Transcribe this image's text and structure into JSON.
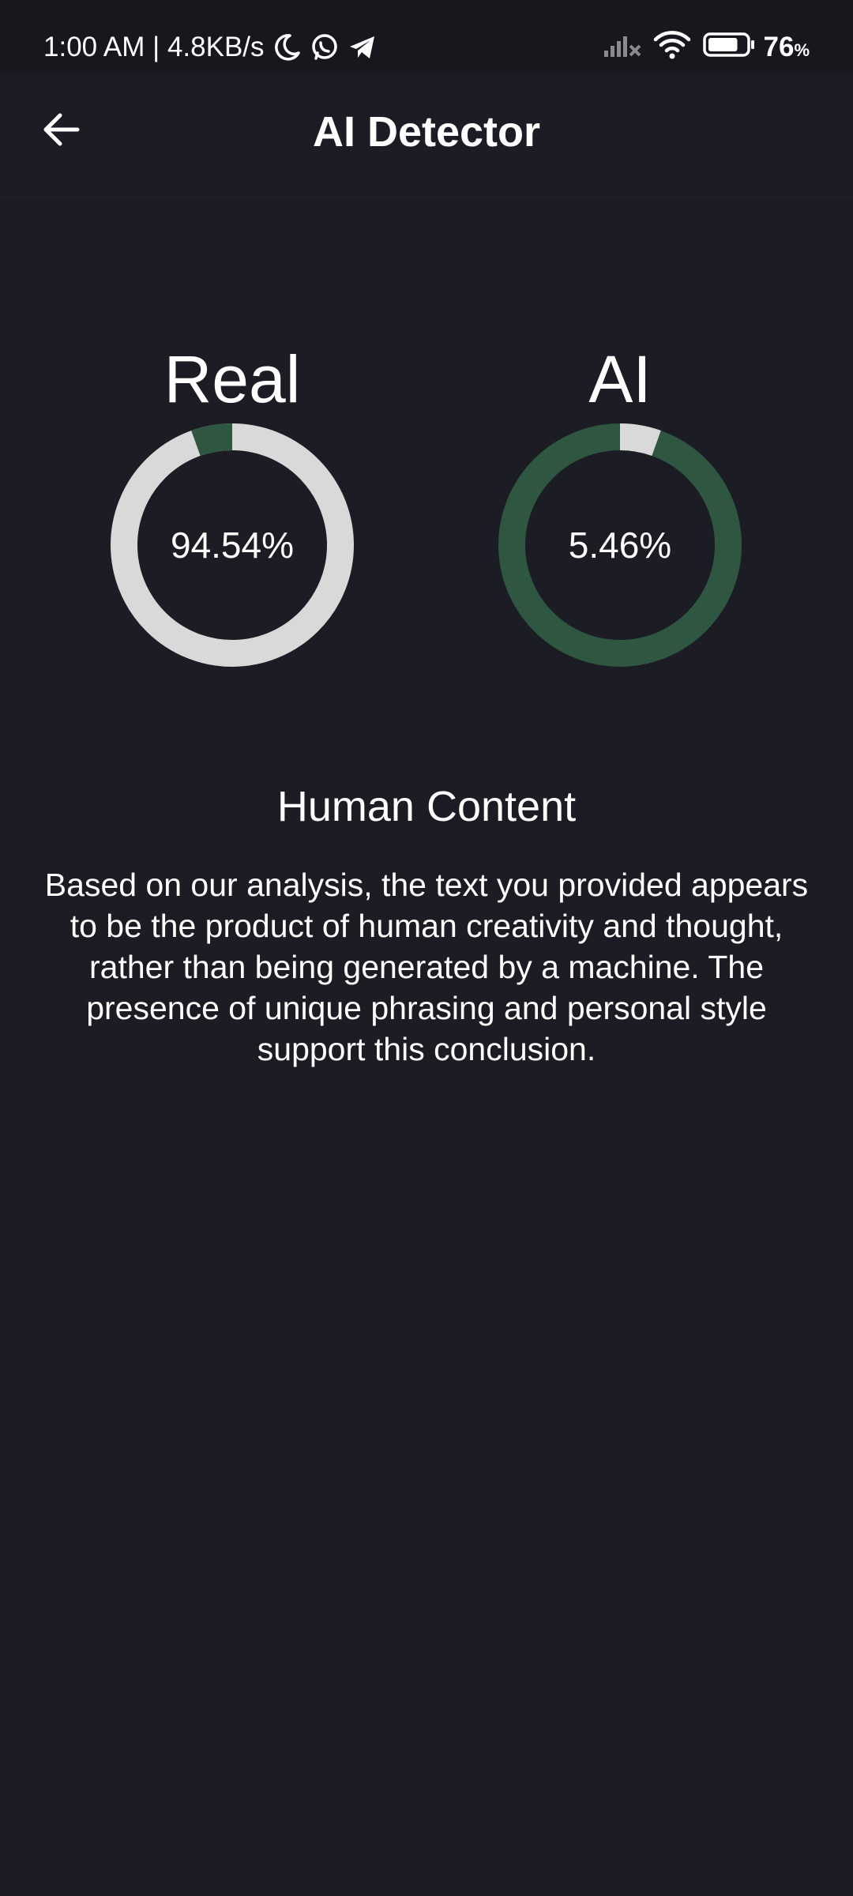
{
  "status_bar": {
    "time_speed": "1:00 AM | 4.8KB/s",
    "battery_percent": "76",
    "battery_unit": "%",
    "icons": [
      "moon-icon",
      "whatsapp-icon",
      "telegram-icon",
      "signal-icon",
      "wifi-icon",
      "battery-icon"
    ],
    "battery_level": 0.76
  },
  "app_bar": {
    "title": "AI Detector",
    "back_icon": "arrow-left-icon"
  },
  "gauges": {
    "real": {
      "label": "Real",
      "value_text": "94.54%",
      "fraction": 0.9454
    },
    "ai": {
      "label": "AI",
      "value_text": "5.46%",
      "fraction": 0.0546
    }
  },
  "colors": {
    "background": "#1c1d24",
    "status_bar": "#17181d",
    "ring_light": "#d9d9d9",
    "ring_green": "#2e5641"
  },
  "result": {
    "heading": "Human Content",
    "description": "Based on our analysis, the text you provided appears to be the product of human creativity and thought, rather than being generated by a machine. The presence of unique phrasing and personal style support this conclusion."
  }
}
